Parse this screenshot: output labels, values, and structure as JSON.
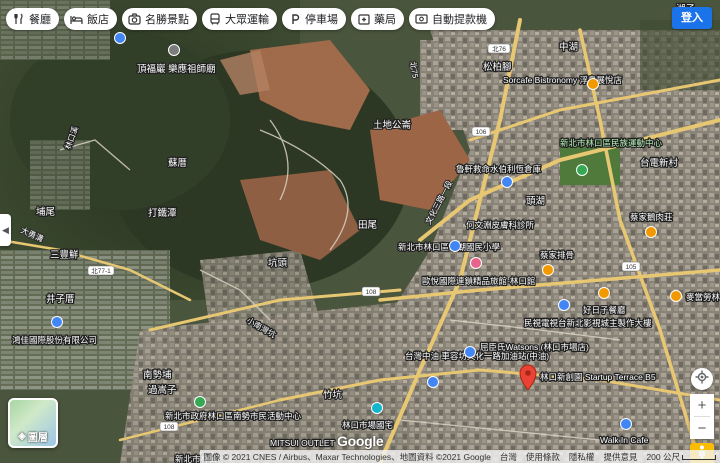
{
  "categories": [
    {
      "label": "餐廳",
      "icon": "restaurant-icon"
    },
    {
      "label": "飯店",
      "icon": "bed-icon"
    },
    {
      "label": "名勝景點",
      "icon": "camera-icon"
    },
    {
      "label": "大眾運輸",
      "icon": "bus-icon"
    },
    {
      "label": "停車場",
      "icon": "parking-icon"
    },
    {
      "label": "藥局",
      "icon": "pharmacy-icon"
    },
    {
      "label": "自動提款機",
      "icon": "atm-icon"
    }
  ],
  "signin_label": "登入",
  "layers_label": "圖層",
  "map_labels": [
    {
      "text": "頂福巖 樂應祖師廟"
    },
    {
      "text": "蘇厝"
    },
    {
      "text": "打鐵潭"
    },
    {
      "text": "埔尾"
    },
    {
      "text": "坑頭"
    },
    {
      "text": "三豐鮮"
    },
    {
      "text": "井子厝"
    },
    {
      "text": "鴻佳國際股份有限公司"
    },
    {
      "text": "南勢埔"
    },
    {
      "text": "過嵩子"
    },
    {
      "text": "新北市政府林口區南勢市民活動中心"
    },
    {
      "text": "中湖"
    },
    {
      "text": "松柏腳"
    },
    {
      "text": "Sorcafe Bistronomy 浮島展悅店"
    },
    {
      "text": "土地公崙"
    },
    {
      "text": "新北市林口區民族運動中心"
    },
    {
      "text": "魯軒救命水伯利恆倉庫"
    },
    {
      "text": "台電新村"
    },
    {
      "text": "頭湖"
    },
    {
      "text": "田尾"
    },
    {
      "text": "何文淵皮膚科診所"
    },
    {
      "text": "蔡家鵝肉莊"
    },
    {
      "text": "新北市林口區頭湖國民小學"
    },
    {
      "text": "歐悅國際連鎖精品旅館-林口館"
    },
    {
      "text": "蔡家排骨"
    },
    {
      "text": "好日子餐廳"
    },
    {
      "text": "麥當勞林"
    },
    {
      "text": "民視電視台新北影視城主製作大樓"
    },
    {
      "text": "屈臣氏Watsons (林口市場店)"
    },
    {
      "text": "台灣中油 車容坊文化一路加油站(中油)"
    },
    {
      "text": "林口新創園 Startup Terrace B5"
    },
    {
      "text": "林口市場國宅"
    },
    {
      "text": "竹坑"
    },
    {
      "text": "Walk In Cafe"
    },
    {
      "text": "MITSUI OUTLET"
    },
    {
      "text": "小南灣坑"
    },
    {
      "text": "林口溪"
    },
    {
      "text": "湖子"
    },
    {
      "text": "新北市林口"
    }
  ],
  "road_labels": [
    "北76",
    "108",
    "106",
    "105",
    "北77-1",
    "文化三路一段",
    "大勇溝",
    "北75"
  ],
  "attribution": {
    "imagery": "圖像 © 2021 CNES / Airbus、Maxar Technologies、地圖資料 ©2021 Google",
    "country": "台灣",
    "terms": "使用條款",
    "privacy": "隱私權",
    "feedback": "提供意見",
    "scale": "200 公尺"
  },
  "logo": "Google",
  "colors": {
    "terrain_dark": "#2f3b26",
    "terrain_mid": "#4c5a3d",
    "urban": "#8a8478",
    "clearing": "#a06b4a",
    "road": "#e8c773",
    "primary_button": "#1a73e8",
    "pin_red": "#ea4335",
    "pin_orange": "#f29900",
    "pin_blue": "#4285f4",
    "pin_green": "#34a853",
    "pin_pink": "#e8638c",
    "pin_teal": "#12b5cb"
  }
}
